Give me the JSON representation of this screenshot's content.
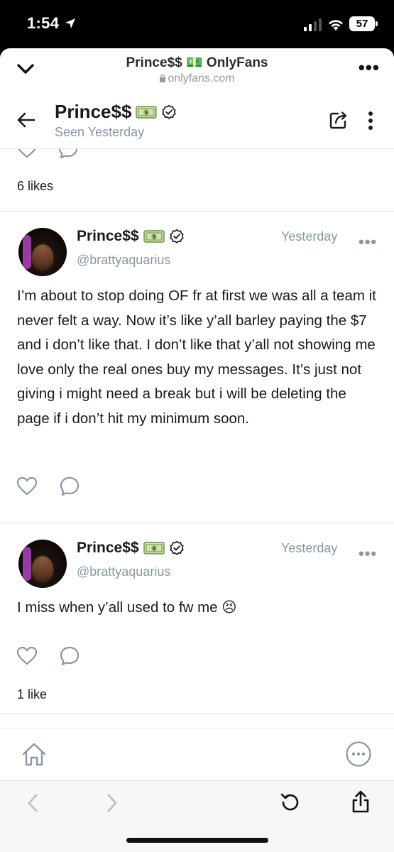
{
  "status_bar": {
    "time": "1:54",
    "battery": "57",
    "icons": [
      "location-arrow-icon",
      "signal-bars-icon",
      "wifi-icon",
      "battery-icon"
    ]
  },
  "browser": {
    "page_title": "Prince$$ 💵 OnlyFans",
    "url": "onlyfans.com"
  },
  "chat": {
    "name": "Prince$$",
    "last_seen": "Seen Yesterday"
  },
  "feed": {
    "previous_post_likes": "6 likes",
    "posts": [
      {
        "author": "Prince$$",
        "handle": "@brattyaquarius",
        "time": "Yesterday",
        "text": "I’m about to stop doing OF fr at first we was all a team it never felt a way. Now it’s like y’all barley paying the $7 and i don’t like that. I don’t like that y’all not showing me love only the real ones buy my messages. It’s just not giving i might need a break but i will be deleting the page if i don’t hit my minimum soon.",
        "likes": ""
      },
      {
        "author": "Prince$$",
        "handle": "@brattyaquarius",
        "time": "Yesterday",
        "text": "I miss when y’all used to fw me 😣",
        "likes": "1 like"
      }
    ]
  },
  "colors": {
    "muted": "#8a96a3",
    "text": "#1a1a1a",
    "divider": "#e3e3e3"
  }
}
